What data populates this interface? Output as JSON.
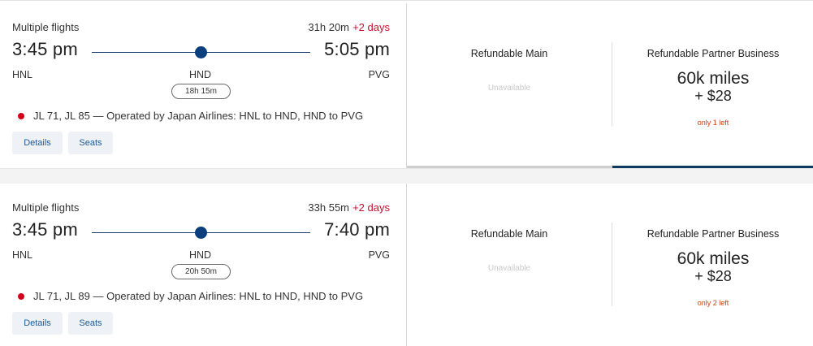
{
  "flights": [
    {
      "label": "Multiple flights",
      "duration": "31h 20m",
      "plus_days": "+2 days",
      "depart_time": "3:45 pm",
      "arrive_time": "5:05 pm",
      "depart_airport": "HNL",
      "stop_airport": "HND",
      "arrive_airport": "PVG",
      "layover": "18h 15m",
      "flight_info": "JL 71, JL 85 — Operated by Japan Airlines: HNL to HND, HND to PVG",
      "details_label": "Details",
      "seats_label": "Seats",
      "fares": {
        "main_title": "Refundable Main",
        "main_status": "Unavailable",
        "partner_title": "Refundable Partner Business",
        "partner_miles": "60k miles",
        "partner_fee": "+ $28",
        "partner_left": "only 1 left"
      }
    },
    {
      "label": "Multiple flights",
      "duration": "33h 55m",
      "plus_days": "+2 days",
      "depart_time": "3:45 pm",
      "arrive_time": "7:40 pm",
      "depart_airport": "HNL",
      "stop_airport": "HND",
      "arrive_airport": "PVG",
      "layover": "20h 50m",
      "flight_info": "JL 71, JL 89 — Operated by Japan Airlines: HNL to HND, HND to PVG",
      "details_label": "Details",
      "seats_label": "Seats",
      "fares": {
        "main_title": "Refundable Main",
        "main_status": "Unavailable",
        "partner_title": "Refundable Partner Business",
        "partner_miles": "60k miles",
        "partner_fee": "+ $28",
        "partner_left": "only 2 left"
      }
    }
  ],
  "colors": {
    "accent_red": "#c8102e",
    "route_blue": "#0b3f7e",
    "link_blue": "#1c5a96",
    "selected_bar": "#0e3a5f",
    "seats_left_orange": "#c8400a"
  },
  "icons": {
    "airline": "japan-airlines-logo-icon"
  }
}
